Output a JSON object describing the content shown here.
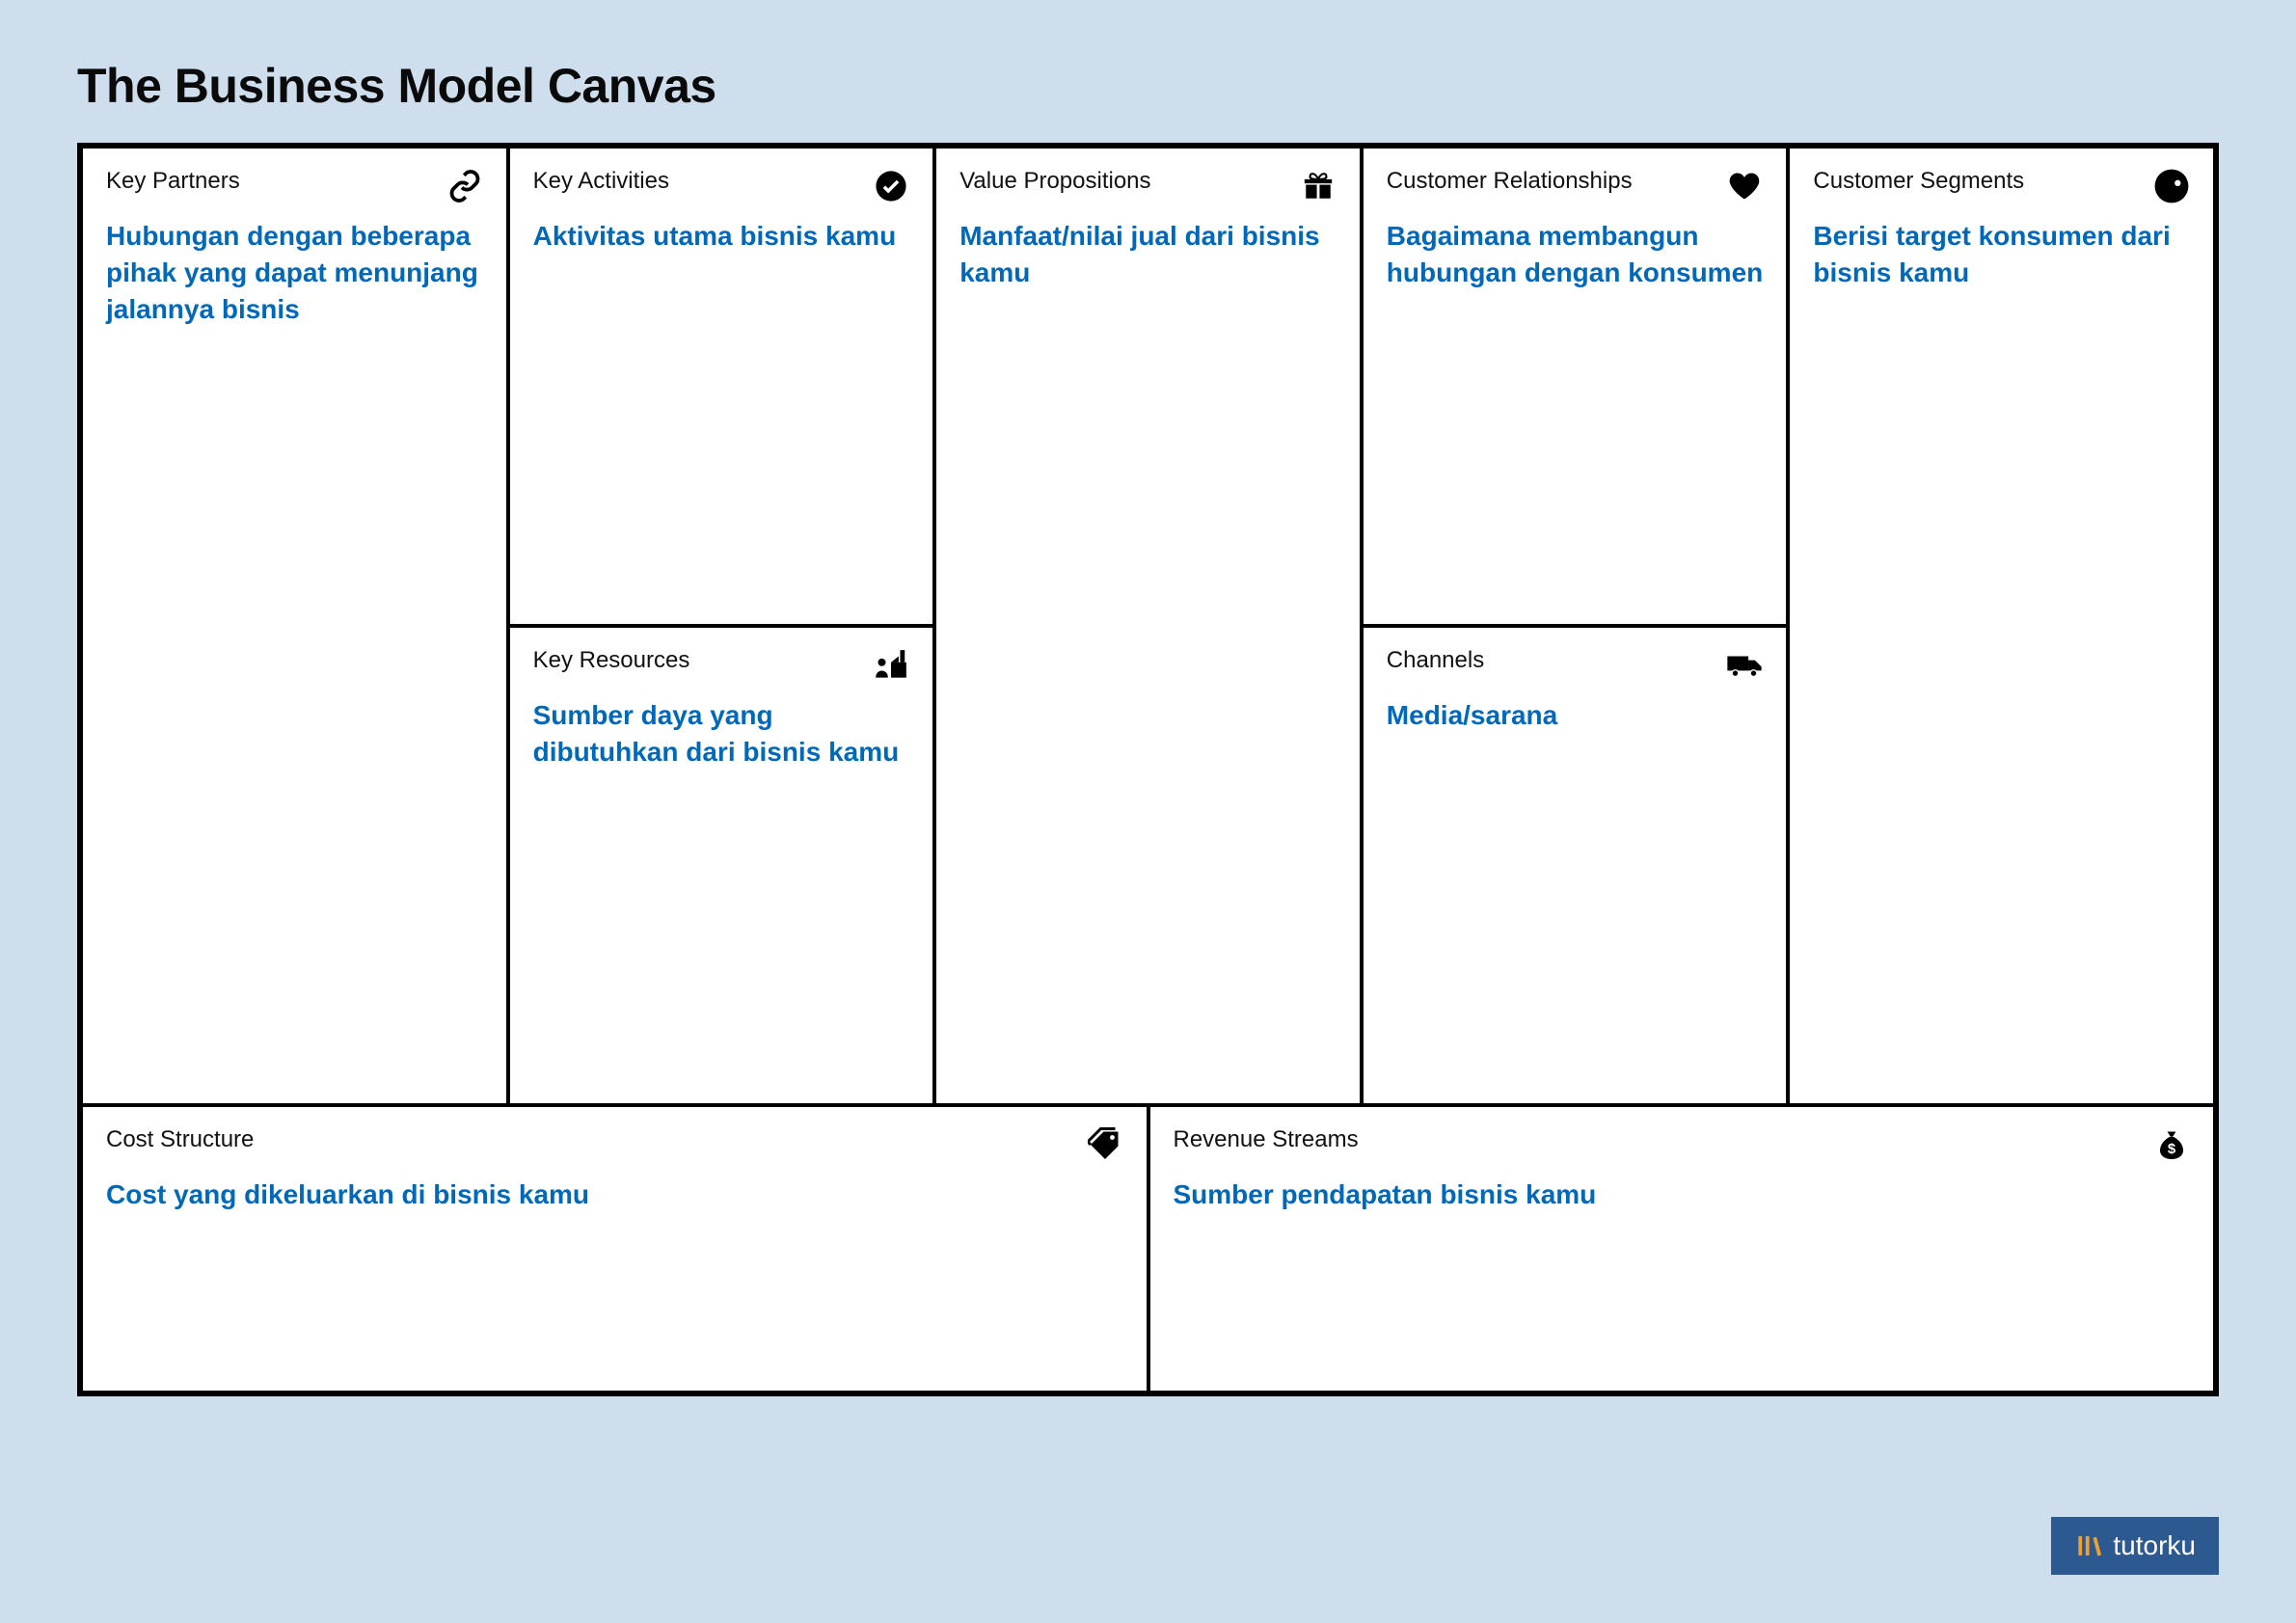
{
  "title": "The Business Model Canvas",
  "blocks": {
    "key_partners": {
      "label": "Key Partners",
      "content": "Hubungan dengan beberapa pihak yang dapat menunjang jalannya bisnis",
      "icon": "link-icon"
    },
    "key_activities": {
      "label": "Key Activities",
      "content": "Aktivitas utama bisnis kamu",
      "icon": "check-circle-icon"
    },
    "key_resources": {
      "label": "Key Resources",
      "content": "Sumber daya yang dibutuhkan dari bisnis kamu",
      "icon": "factory-icon"
    },
    "value_propositions": {
      "label": "Value Propositions",
      "content": "Manfaat/nilai jual dari bisnis kamu",
      "icon": "gift-icon"
    },
    "customer_relationships": {
      "label": "Customer Relationships",
      "content": "Bagaimana membangun hubungan dengan konsumen",
      "icon": "heart-icon"
    },
    "channels": {
      "label": "Channels",
      "content": "Media/sarana",
      "icon": "truck-icon"
    },
    "customer_segments": {
      "label": "Customer Segments",
      "content": "Berisi target konsumen dari bisnis kamu",
      "icon": "person-icon"
    },
    "cost_structure": {
      "label": "Cost Structure",
      "content": "Cost yang dikeluarkan di bisnis kamu",
      "icon": "tag-icon"
    },
    "revenue_streams": {
      "label": "Revenue Streams",
      "content": "Sumber pendapatan bisnis kamu",
      "icon": "moneybag-icon"
    }
  },
  "branding": {
    "text": "tutorku"
  }
}
